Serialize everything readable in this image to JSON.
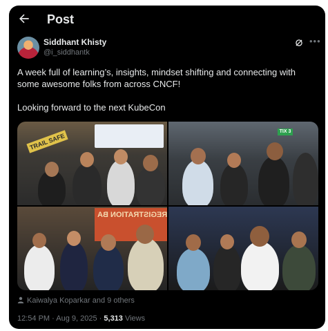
{
  "header": {
    "title": "Post"
  },
  "author": {
    "name": "Siddhant Khisty",
    "handle": "@i_siddhantk"
  },
  "post": {
    "text_line1": "A week full of learning’s, insights, mindset shifting and connecting with some awesome folks from across CNCF!",
    "text_line2": "Looking forward to the next KubeCon"
  },
  "photos": {
    "p1_sign": "TRAIL SAFE",
    "p3_banner": "REGISTRATION BA",
    "p2_sign": "TIX 3"
  },
  "likes": {
    "text": "Kaiwalya Koparkar and 9 others"
  },
  "meta": {
    "time": "12:54 PM",
    "sep1": " · ",
    "date": "Aug 9, 2025",
    "sep2": " · ",
    "views_count": "5,313",
    "views_label": " Views"
  },
  "icons": {
    "back": "arrow-left-icon",
    "grok": "grok-icon",
    "more": "more-horizontal-icon",
    "person": "person-icon"
  },
  "colors": {
    "background": "#000000",
    "text": "#e7e9ea",
    "secondary": "#71767b"
  }
}
